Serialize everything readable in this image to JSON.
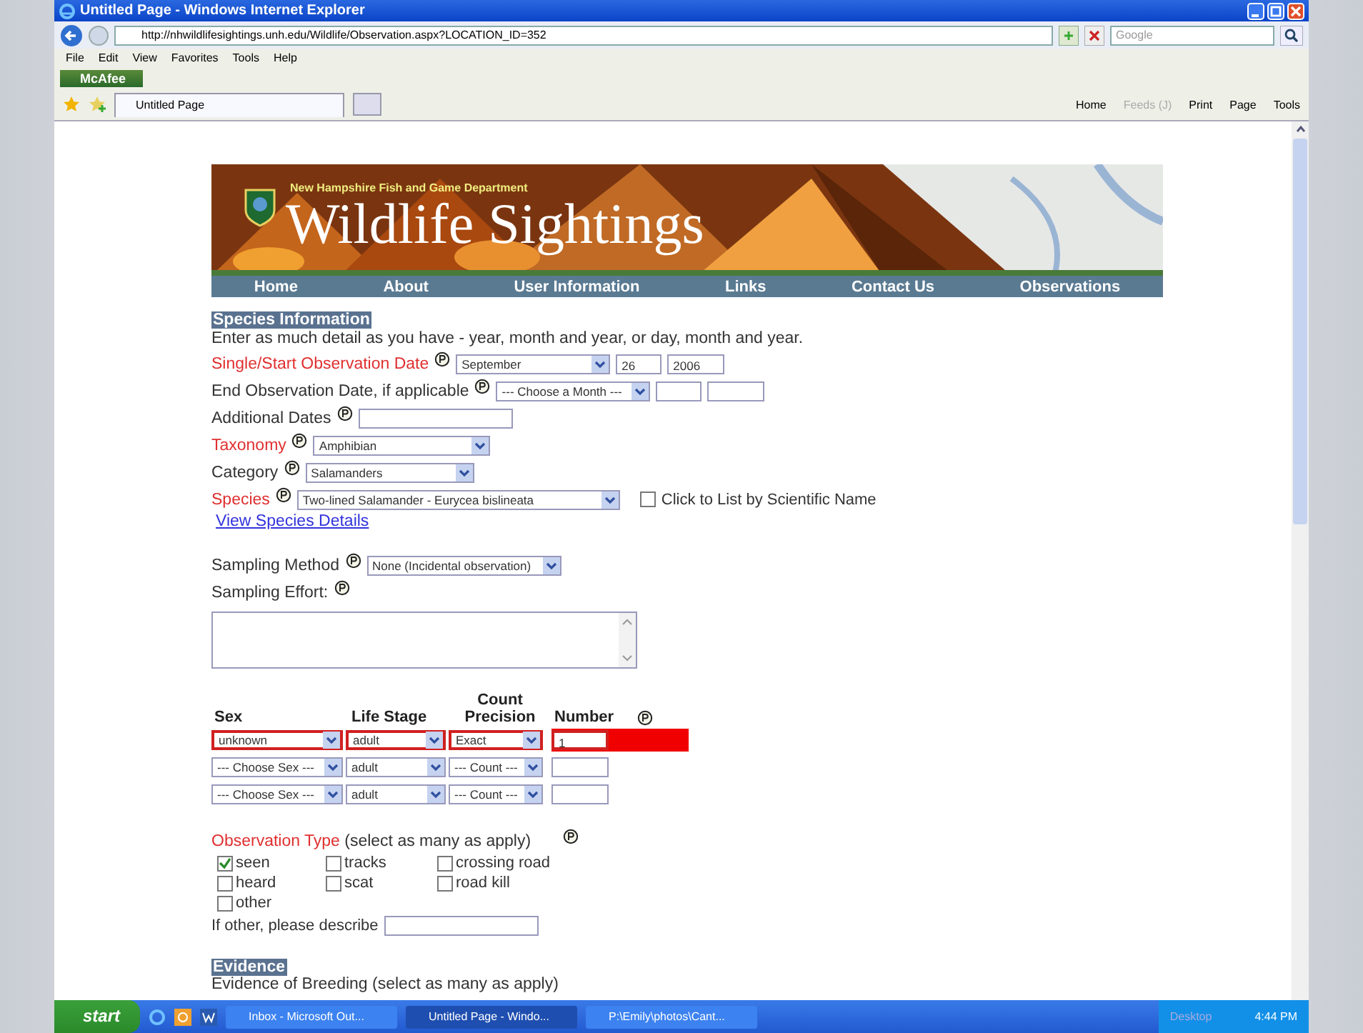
{
  "window": {
    "title": "Untitled Page - Windows Internet Explorer"
  },
  "address_bar": {
    "url": "http://nhwildlifesightings.unh.edu/Wildlife/Observation.aspx?LOCATION_ID=352",
    "search_placeholder": "Google"
  },
  "menu": [
    "File",
    "Edit",
    "View",
    "Favorites",
    "Tools",
    "Help"
  ],
  "addon_toolbar": {
    "label": "McAfee"
  },
  "tabs": [
    {
      "label": "Untitled Page",
      "selected": true
    }
  ],
  "command_bar": [
    {
      "label": "Home",
      "disabled": false
    },
    {
      "label": "Feeds (J)",
      "disabled": true
    },
    {
      "label": "Print",
      "disabled": false
    },
    {
      "label": "Page",
      "disabled": false
    },
    {
      "label": "Tools",
      "disabled": false
    }
  ],
  "banner": {
    "agency": "New Hampshire Fish and Game Department",
    "title": "Wildlife Sightings"
  },
  "nav": [
    "Home",
    "About",
    "User Information",
    "Links",
    "Contact Us",
    "Observations"
  ],
  "species_section": {
    "heading": "Species Information",
    "intro": "Enter as much detail as you have - year, month and year, or day, month and year."
  },
  "fields": [
    {
      "label": "Single/Start Observation Date",
      "required": true,
      "controls": [
        {
          "kind": "select",
          "value": "September"
        },
        {
          "kind": "text",
          "value": "26"
        },
        {
          "kind": "text",
          "value": "2006"
        }
      ]
    },
    {
      "label": "End Observation Date, if applicable",
      "required": false,
      "controls": [
        {
          "kind": "select",
          "value": "--- Choose a Month ---"
        },
        {
          "kind": "text"
        },
        {
          "kind": "text"
        }
      ]
    },
    {
      "label": "Additional Dates",
      "required": false,
      "controls": [
        {
          "kind": "text"
        }
      ]
    },
    {
      "label": "Taxonomy",
      "required": true,
      "controls": [
        {
          "kind": "select",
          "value": "Amphibian"
        }
      ]
    },
    {
      "label": "Category",
      "required": false,
      "controls": [
        {
          "kind": "select",
          "value": "Salamanders"
        }
      ]
    },
    {
      "label": "Species",
      "required": true,
      "controls": [
        {
          "kind": "select",
          "value": "Two-lined Salamander - Eurycea bislineata"
        },
        {
          "kind": "checkbox",
          "label": "Click to List by Scientific Name",
          "checked": false
        }
      ]
    }
  ],
  "species_details_link": "View Species Details",
  "sampling_method": {
    "label": "Sampling Method",
    "value": "None (Incidental observation)"
  },
  "sampling_effort": {
    "label": "Sampling Effort:"
  },
  "count_table": {
    "columns": [
      "Sex",
      "Life Stage",
      "Count Precision",
      "Number"
    ],
    "rows": [
      {
        "sex": "unknown",
        "life_stage": "adult",
        "precision": "Exact",
        "number": "1",
        "error": true
      },
      {
        "sex": "--- Choose Sex ---",
        "life_stage": "adult",
        "precision": "--- Count ---",
        "number": "",
        "error": false
      },
      {
        "sex": "--- Choose Sex ---",
        "life_stage": "adult",
        "precision": "--- Count ---",
        "number": "",
        "error": false
      }
    ]
  },
  "observation_type": {
    "label": "Observation Type",
    "note": "(select as many as apply)",
    "options": [
      {
        "label": "seen",
        "checked": true
      },
      {
        "label": "tracks",
        "checked": false
      },
      {
        "label": "crossing road",
        "checked": false
      },
      {
        "label": "heard",
        "checked": false
      },
      {
        "label": "scat",
        "checked": false
      },
      {
        "label": "road kill",
        "checked": false
      },
      {
        "label": "other",
        "checked": false
      }
    ]
  },
  "other_describe": {
    "label": "If other, please describe"
  },
  "evidence_section": {
    "heading": "Evidence",
    "breeding_label": "Evidence of Breeding (select as many as apply)"
  },
  "taskbar": {
    "start": "start",
    "tasks": [
      {
        "label": "Inbox - Microsoft Out...",
        "selected": false
      },
      {
        "label": "Untitled Page - Windo...",
        "selected": true
      },
      {
        "label": "P:\\Emily\\photos\\Cant...",
        "selected": false
      }
    ],
    "desktop": "Desktop",
    "clock": "4:44 PM"
  }
}
